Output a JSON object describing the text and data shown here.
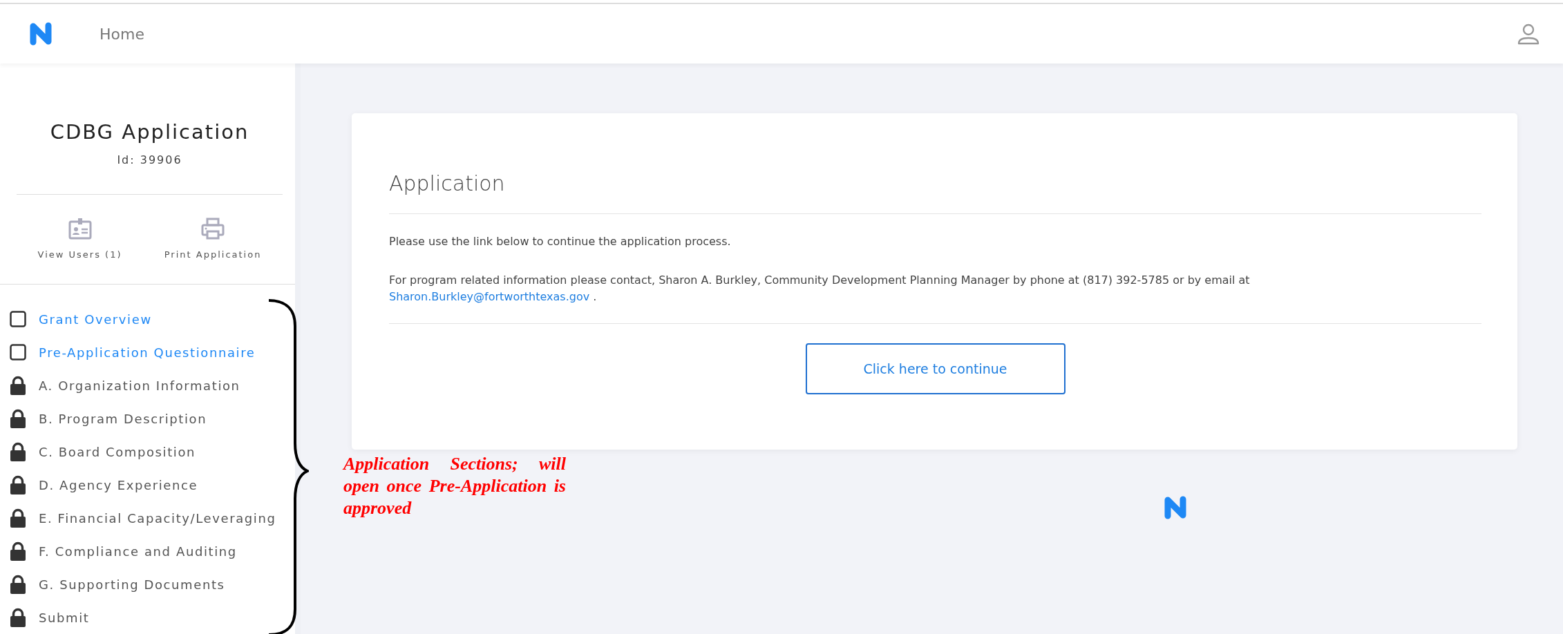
{
  "header": {
    "nav_link": "Home"
  },
  "sidebar": {
    "title": "CDBG Application",
    "id_label": "Id: 39906",
    "actions": [
      {
        "kind": "users",
        "label": "View Users (1)"
      },
      {
        "kind": "print",
        "label": "Print Application"
      }
    ],
    "sections": [
      {
        "kind": "checkbox",
        "label": "Grant Overview",
        "checked": false
      },
      {
        "kind": "checkbox",
        "label": "Pre-Application Questionnaire",
        "checked": false
      },
      {
        "kind": "locked",
        "label": "A. Organization Information"
      },
      {
        "kind": "locked",
        "label": "B. Program Description"
      },
      {
        "kind": "locked",
        "label": "C. Board Composition"
      },
      {
        "kind": "locked",
        "label": "D. Agency Experience"
      },
      {
        "kind": "locked",
        "label": "E. Financial Capacity/Leveraging"
      },
      {
        "kind": "locked",
        "label": "F. Compliance and Auditing"
      },
      {
        "kind": "locked",
        "label": "G. Supporting Documents"
      },
      {
        "kind": "locked",
        "label": "Submit"
      }
    ]
  },
  "card": {
    "title": "Application",
    "intro": "Please use the link below to continue the application process.",
    "contact": {
      "text": "For program related information please contact, Sharon A. Burkley, Community Development Planning Manager by phone at (817) 392-5785 or by email at",
      "email": "Sharon.Burkley@fortworthtexas.gov",
      "end": "."
    },
    "button": "Click here to continue"
  },
  "annotation": "Application Sections; will open once Pre-Application is approved"
}
